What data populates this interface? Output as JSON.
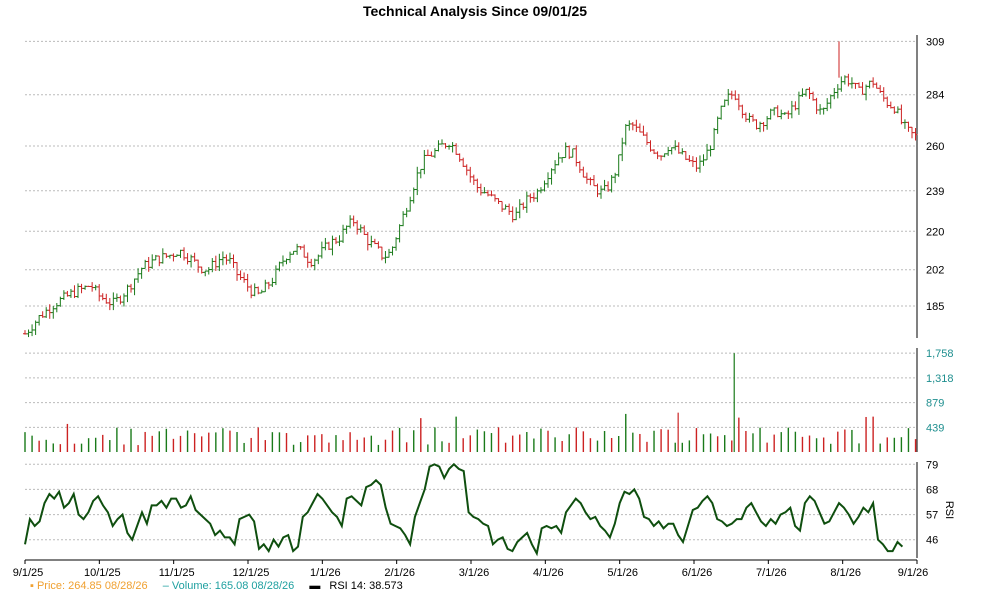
{
  "chart_data": {
    "type": "line",
    "title": "Technical Analysis Since 09/01/25",
    "x_labels": [
      "9/1/25",
      "10/1/25",
      "11/1/25",
      "12/1/25",
      "1/1/26",
      "2/1/26",
      "3/1/26",
      "4/1/26",
      "5/1/26",
      "6/1/26",
      "7/1/26",
      "8/1/26",
      "9/1/26"
    ],
    "price": {
      "y_ticks": [
        185,
        202,
        220,
        239,
        260,
        284,
        309
      ],
      "ylim": [
        170,
        312
      ],
      "points": [
        [
          0,
          172
        ],
        [
          3,
          176
        ],
        [
          6,
          180
        ],
        [
          9,
          183
        ],
        [
          12,
          186
        ],
        [
          15,
          188
        ],
        [
          18,
          190
        ],
        [
          21,
          192
        ],
        [
          24,
          193
        ],
        [
          27,
          195
        ],
        [
          30,
          190
        ],
        [
          33,
          188
        ],
        [
          36,
          186
        ],
        [
          39,
          189
        ],
        [
          42,
          193
        ],
        [
          45,
          198
        ],
        [
          48,
          203
        ],
        [
          51,
          205
        ],
        [
          54,
          207
        ],
        [
          57,
          208
        ],
        [
          60,
          209
        ],
        [
          63,
          211
        ],
        [
          66,
          209
        ],
        [
          69,
          206
        ],
        [
          72,
          203
        ],
        [
          75,
          202
        ],
        [
          78,
          205
        ],
        [
          81,
          208
        ],
        [
          84,
          206
        ],
        [
          87,
          200
        ],
        [
          90,
          196
        ],
        [
          93,
          192
        ],
        [
          96,
          190
        ],
        [
          99,
          194
        ],
        [
          102,
          198
        ],
        [
          105,
          205
        ],
        [
          108,
          210
        ],
        [
          111,
          212
        ],
        [
          114,
          210
        ],
        [
          117,
          206
        ],
        [
          120,
          208
        ],
        [
          123,
          212
        ],
        [
          126,
          215
        ],
        [
          129,
          217
        ],
        [
          132,
          222
        ],
        [
          135,
          225
        ],
        [
          138,
          220
        ],
        [
          141,
          215
        ],
        [
          144,
          212
        ],
        [
          147,
          208
        ],
        [
          150,
          210
        ],
        [
          153,
          220
        ],
        [
          156,
          230
        ],
        [
          159,
          240
        ],
        [
          162,
          250
        ],
        [
          165,
          255
        ],
        [
          168,
          257
        ],
        [
          171,
          260
        ],
        [
          174,
          262
        ],
        [
          177,
          258
        ],
        [
          180,
          252
        ],
        [
          183,
          245
        ],
        [
          186,
          240
        ],
        [
          189,
          238
        ],
        [
          192,
          235
        ],
        [
          195,
          232
        ],
        [
          198,
          230
        ],
        [
          201,
          227
        ],
        [
          204,
          232
        ],
        [
          207,
          236
        ],
        [
          210,
          238
        ],
        [
          213,
          244
        ],
        [
          216,
          250
        ],
        [
          219,
          255
        ],
        [
          222,
          258
        ],
        [
          225,
          256
        ],
        [
          228,
          250
        ],
        [
          231,
          243
        ],
        [
          234,
          240
        ],
        [
          237,
          238
        ],
        [
          240,
          242
        ],
        [
          243,
          250
        ],
        [
          246,
          268
        ],
        [
          249,
          270
        ],
        [
          252,
          266
        ],
        [
          255,
          262
        ],
        [
          258,
          258
        ],
        [
          261,
          256
        ],
        [
          264,
          260
        ],
        [
          267,
          258
        ],
        [
          270,
          255
        ],
        [
          273,
          252
        ],
        [
          276,
          250
        ],
        [
          279,
          255
        ],
        [
          282,
          262
        ],
        [
          285,
          275
        ],
        [
          288,
          282
        ],
        [
          291,
          285
        ],
        [
          294,
          278
        ],
        [
          297,
          272
        ],
        [
          300,
          270
        ],
        [
          303,
          272
        ],
        [
          306,
          275
        ],
        [
          309,
          276
        ],
        [
          312,
          273
        ],
        [
          315,
          278
        ],
        [
          318,
          282
        ],
        [
          321,
          286
        ],
        [
          324,
          280
        ],
        [
          327,
          275
        ],
        [
          330,
          282
        ],
        [
          333,
          288
        ],
        [
          336,
          292
        ],
        [
          339,
          290
        ],
        [
          342,
          285
        ],
        [
          345,
          288
        ],
        [
          348,
          290
        ],
        [
          351,
          284
        ],
        [
          354,
          280
        ],
        [
          357,
          278
        ],
        [
          360,
          270
        ],
        [
          363,
          266
        ],
        [
          366,
          264
        ]
      ]
    },
    "volume": {
      "y_ticks": [
        439,
        879,
        1318,
        1758
      ],
      "ylim": [
        0,
        1850
      ],
      "spike_index": 291,
      "spike_value": 1758
    },
    "rsi": {
      "y_ticks": [
        46,
        57,
        68,
        79
      ],
      "ylim": [
        38,
        80
      ],
      "ylabel": "RSI",
      "points": [
        [
          0,
          44
        ],
        [
          2,
          55
        ],
        [
          4,
          52
        ],
        [
          6,
          54
        ],
        [
          8,
          62
        ],
        [
          10,
          66
        ],
        [
          12,
          64
        ],
        [
          14,
          67
        ],
        [
          16,
          60
        ],
        [
          18,
          62
        ],
        [
          20,
          66
        ],
        [
          22,
          57
        ],
        [
          24,
          55
        ],
        [
          26,
          58
        ],
        [
          28,
          63
        ],
        [
          30,
          65
        ],
        [
          32,
          61
        ],
        [
          34,
          58
        ],
        [
          36,
          52
        ],
        [
          38,
          55
        ],
        [
          40,
          57
        ],
        [
          42,
          49
        ],
        [
          44,
          46
        ],
        [
          46,
          52
        ],
        [
          48,
          58
        ],
        [
          50,
          53
        ],
        [
          52,
          61
        ],
        [
          54,
          61
        ],
        [
          56,
          63
        ],
        [
          58,
          60
        ],
        [
          60,
          64
        ],
        [
          62,
          64
        ],
        [
          64,
          60
        ],
        [
          66,
          61
        ],
        [
          68,
          65
        ],
        [
          70,
          59
        ],
        [
          72,
          57
        ],
        [
          74,
          55
        ],
        [
          76,
          53
        ],
        [
          78,
          48
        ],
        [
          80,
          50
        ],
        [
          82,
          47
        ],
        [
          84,
          47
        ],
        [
          86,
          44
        ],
        [
          88,
          55
        ],
        [
          90,
          56
        ],
        [
          92,
          57
        ],
        [
          94,
          54
        ],
        [
          96,
          42
        ],
        [
          98,
          44
        ],
        [
          100,
          41
        ],
        [
          102,
          46
        ],
        [
          104,
          43
        ],
        [
          106,
          47
        ],
        [
          108,
          48
        ],
        [
          110,
          41
        ],
        [
          112,
          43
        ],
        [
          114,
          56
        ],
        [
          116,
          58
        ],
        [
          118,
          62
        ],
        [
          120,
          66
        ],
        [
          122,
          64
        ],
        [
          124,
          61
        ],
        [
          126,
          58
        ],
        [
          128,
          56
        ],
        [
          130,
          52
        ],
        [
          132,
          64
        ],
        [
          134,
          65
        ],
        [
          136,
          63
        ],
        [
          138,
          61
        ],
        [
          140,
          69
        ],
        [
          142,
          70
        ],
        [
          144,
          72
        ],
        [
          146,
          70
        ],
        [
          148,
          60
        ],
        [
          150,
          53
        ],
        [
          152,
          52
        ],
        [
          154,
          51
        ],
        [
          156,
          48
        ],
        [
          158,
          44
        ],
        [
          160,
          56
        ],
        [
          162,
          62
        ],
        [
          164,
          68
        ],
        [
          166,
          78
        ],
        [
          168,
          79
        ],
        [
          170,
          78
        ],
        [
          172,
          73
        ],
        [
          174,
          77
        ],
        [
          176,
          79
        ],
        [
          178,
          77
        ],
        [
          180,
          76
        ],
        [
          182,
          58
        ],
        [
          184,
          56
        ],
        [
          186,
          55
        ],
        [
          188,
          53
        ],
        [
          190,
          52
        ],
        [
          192,
          44
        ],
        [
          194,
          46
        ],
        [
          196,
          47
        ],
        [
          198,
          42
        ],
        [
          200,
          41
        ],
        [
          202,
          45
        ],
        [
          204,
          47
        ],
        [
          206,
          49
        ],
        [
          208,
          44
        ],
        [
          210,
          40
        ],
        [
          212,
          51
        ],
        [
          214,
          52
        ],
        [
          216,
          51
        ],
        [
          218,
          52
        ],
        [
          220,
          49
        ],
        [
          222,
          58
        ],
        [
          224,
          61
        ],
        [
          226,
          64
        ],
        [
          228,
          62
        ],
        [
          230,
          58
        ],
        [
          232,
          55
        ],
        [
          234,
          56
        ],
        [
          236,
          52
        ],
        [
          238,
          50
        ],
        [
          240,
          47
        ],
        [
          242,
          53
        ],
        [
          244,
          62
        ],
        [
          246,
          67
        ],
        [
          248,
          66
        ],
        [
          250,
          68
        ],
        [
          252,
          64
        ],
        [
          254,
          56
        ],
        [
          256,
          55
        ],
        [
          258,
          52
        ],
        [
          260,
          54
        ],
        [
          262,
          51
        ],
        [
          264,
          53
        ],
        [
          266,
          53
        ],
        [
          268,
          48
        ],
        [
          270,
          45
        ],
        [
          272,
          52
        ],
        [
          274,
          59
        ],
        [
          276,
          60
        ],
        [
          278,
          63
        ],
        [
          280,
          65
        ],
        [
          282,
          62
        ],
        [
          284,
          55
        ],
        [
          286,
          54
        ],
        [
          288,
          52
        ],
        [
          290,
          53
        ],
        [
          292,
          55
        ],
        [
          294,
          55
        ],
        [
          296,
          60
        ],
        [
          298,
          62
        ],
        [
          300,
          58
        ],
        [
          302,
          54
        ],
        [
          304,
          52
        ],
        [
          306,
          55
        ],
        [
          308,
          53
        ],
        [
          310,
          57
        ],
        [
          312,
          58
        ],
        [
          314,
          60
        ],
        [
          316,
          52
        ],
        [
          318,
          50
        ],
        [
          320,
          62
        ],
        [
          322,
          65
        ],
        [
          324,
          63
        ],
        [
          326,
          58
        ],
        [
          328,
          53
        ],
        [
          330,
          54
        ],
        [
          332,
          58
        ],
        [
          334,
          62
        ],
        [
          336,
          60
        ],
        [
          338,
          57
        ],
        [
          340,
          53
        ],
        [
          342,
          56
        ],
        [
          344,
          60
        ],
        [
          346,
          58
        ],
        [
          348,
          62
        ],
        [
          350,
          46
        ],
        [
          352,
          44
        ],
        [
          354,
          41
        ],
        [
          356,
          41
        ],
        [
          358,
          45
        ],
        [
          360,
          43
        ]
      ]
    }
  },
  "legend": {
    "price_label": "Price: 264.85  08/28/26",
    "volume_label": "Volume: 165.08  08/28/26",
    "rsi_label": "RSI 14: 38.573"
  },
  "colors": {
    "up": "#1a7a1a",
    "down": "#cc2222",
    "rsi_line": "#0f4f0f",
    "volume_label": "#1f8f8f",
    "grid": "#bbbbbb",
    "price_legend": "#f0a030"
  }
}
